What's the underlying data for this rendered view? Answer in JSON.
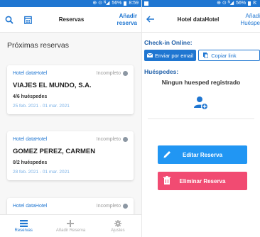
{
  "left": {
    "status": {
      "indicators": "⊕ ⊙ ᴺ◢",
      "battery": "56%",
      "time": "8:59"
    },
    "appbar": {
      "title": "Reservas",
      "action_line1": "Añadir",
      "action_line2": "reserva"
    },
    "section_title": "Próximas reservas",
    "reservations": [
      {
        "hotel": "Hotel dataHotel",
        "status": "Incompleto",
        "name": "VIAJES EL MUNDO, S.A.",
        "guests": "4/6 huéspedes",
        "dates": "25 feb. 2021 - 01 mar. 2021"
      },
      {
        "hotel": "Hotel dataHotel",
        "status": "Incompleto",
        "name": "GOMEZ PEREZ, CARMEN",
        "guests": "0/2 huéspedes",
        "dates": "28 feb. 2021 - 01 mar. 2021"
      },
      {
        "hotel": "Hotel dataHotel",
        "status": "Incompleto"
      }
    ],
    "bottom_nav": [
      {
        "label": "Reservas",
        "icon": "list-icon",
        "active": true
      },
      {
        "label": "Añadir Reserva",
        "icon": "plus-icon",
        "active": false
      },
      {
        "label": "Ajustes",
        "icon": "gear-icon",
        "active": false
      }
    ]
  },
  "right": {
    "status": {
      "indicators": "⊕ ⊙ ᴺ◢",
      "battery": "56%",
      "time": "8:"
    },
    "appbar": {
      "title": "Hotel dataHotel",
      "action_line1": "Añadi",
      "action_line2": "Huéspe"
    },
    "checkin_label": "Check-in Online:",
    "send_email_label": "Enviar por email",
    "copy_link_label": "Copiar link",
    "guests_label": "Huéspedes:",
    "no_guests_text": "Ningun huesped registrado",
    "edit_label": "Editar Reserva",
    "delete_label": "Eliminar Reserva"
  },
  "colors": {
    "primary": "#1f76d1",
    "edit": "#2196f3",
    "delete": "#f14b72"
  }
}
